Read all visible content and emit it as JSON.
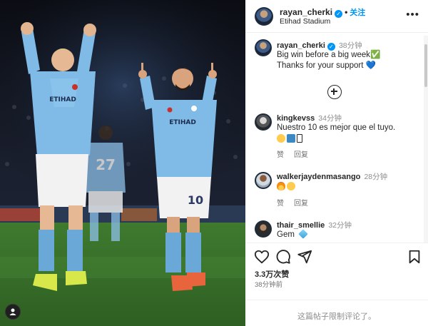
{
  "post": {
    "username": "rayan_cherki",
    "follow_label": "关注",
    "location": "Etihad Stadium",
    "caption_line1": "Big win before a big week✅",
    "caption_line2": "Thanks for your support 💙",
    "caption_time": "38分钟",
    "likes": "3.3万次赞",
    "posted_ago": "38分钟前",
    "comments_limited": "这篇帖子限制评论了。"
  },
  "photo": {
    "player_left_number": "",
    "player_right_number": "10",
    "player_back_number": "27",
    "sponsor": "ETIHAD AIRWAYS"
  },
  "comments": [
    {
      "username": "kingkevss",
      "time": "34分钟",
      "text": "Nuestro 10 es mejor que el tuyo.",
      "emojis": [
        "slightly-smiling-face",
        "keycap-1",
        "box"
      ],
      "reply_like": "赞",
      "reply": "回复"
    },
    {
      "username": "walkerjaydenmasango",
      "time": "28分钟",
      "text": "",
      "emojis": [
        "fire",
        "face-screaming"
      ],
      "reply_like": "赞",
      "reply": "回复"
    },
    {
      "username": "thair_smellie",
      "time": "32分钟",
      "text": "Gem",
      "emojis": [
        "gem"
      ]
    }
  ],
  "icons": {
    "like": "heart-icon",
    "comment": "comment-icon",
    "share": "share-icon",
    "save": "bookmark-icon",
    "more": "more-icon",
    "add": "plus-circle-icon"
  },
  "colors": {
    "verified": "#0095f6",
    "follow": "#0095f6",
    "city_blue": "#6cabdd"
  }
}
